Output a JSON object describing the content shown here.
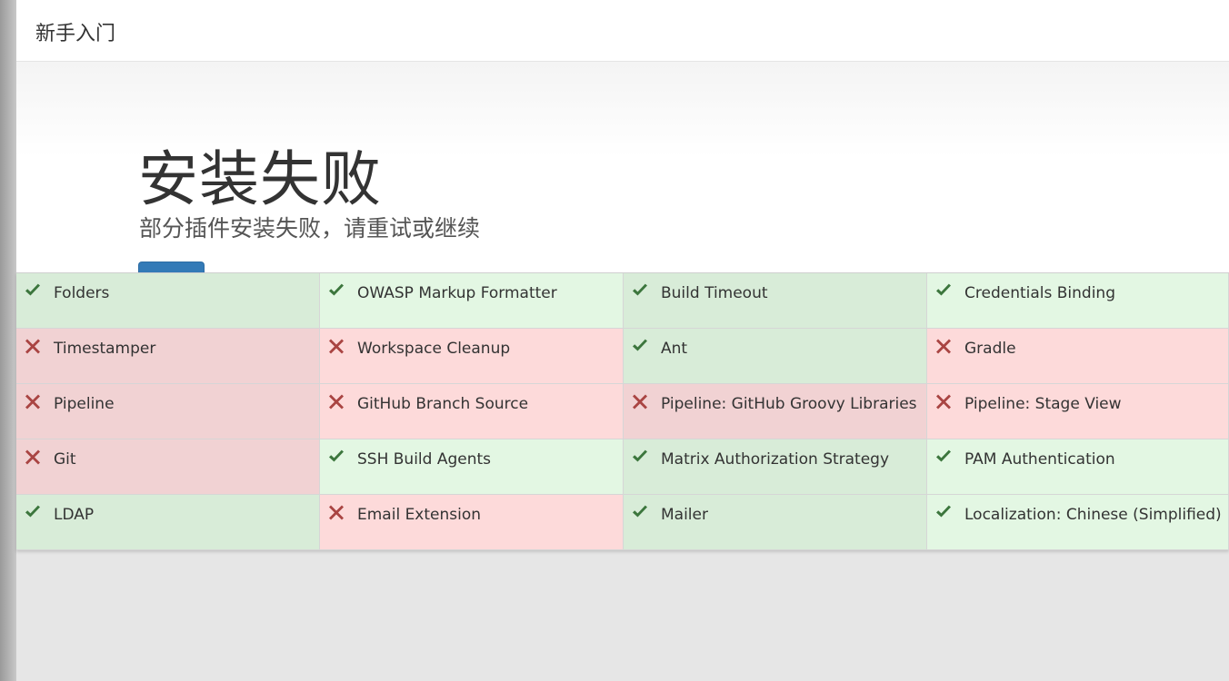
{
  "header": {
    "title": "新手入门"
  },
  "jumbotron": {
    "title": "安装失败",
    "subtitle": "部分插件安装失败，请重试或继续"
  },
  "colors": {
    "success_bg": "#e3f7e3",
    "fail_bg": "#fddada",
    "check": "#3c763d",
    "cross": "#a94442",
    "button": "#337ab7"
  },
  "plugins": [
    {
      "name": "Folders",
      "status": "success",
      "icon": "check-icon"
    },
    {
      "name": "OWASP Markup Formatter",
      "status": "success",
      "icon": "check-icon"
    },
    {
      "name": "Build Timeout",
      "status": "success",
      "icon": "check-icon"
    },
    {
      "name": "Credentials Binding",
      "status": "success",
      "icon": "check-icon"
    },
    {
      "name": "Timestamper",
      "status": "fail",
      "icon": "cross-icon"
    },
    {
      "name": "Workspace Cleanup",
      "status": "fail",
      "icon": "cross-icon"
    },
    {
      "name": "Ant",
      "status": "success",
      "icon": "check-icon"
    },
    {
      "name": "Gradle",
      "status": "fail",
      "icon": "cross-icon"
    },
    {
      "name": "Pipeline",
      "status": "fail",
      "icon": "cross-icon"
    },
    {
      "name": "GitHub Branch Source",
      "status": "fail",
      "icon": "cross-icon"
    },
    {
      "name": "Pipeline: GitHub Groovy Libraries",
      "status": "fail",
      "icon": "cross-icon"
    },
    {
      "name": "Pipeline: Stage View",
      "status": "fail",
      "icon": "cross-icon"
    },
    {
      "name": "Git",
      "status": "fail",
      "icon": "cross-icon"
    },
    {
      "name": "SSH Build Agents",
      "status": "success",
      "icon": "check-icon"
    },
    {
      "name": "Matrix Authorization Strategy",
      "status": "success",
      "icon": "check-icon"
    },
    {
      "name": "PAM Authentication",
      "status": "success",
      "icon": "check-icon"
    },
    {
      "name": "LDAP",
      "status": "success",
      "icon": "check-icon"
    },
    {
      "name": "Email Extension",
      "status": "fail",
      "icon": "cross-icon"
    },
    {
      "name": "Mailer",
      "status": "success",
      "icon": "check-icon"
    },
    {
      "name": "Localization: Chinese (Simplified)",
      "status": "success",
      "icon": "check-icon"
    }
  ]
}
